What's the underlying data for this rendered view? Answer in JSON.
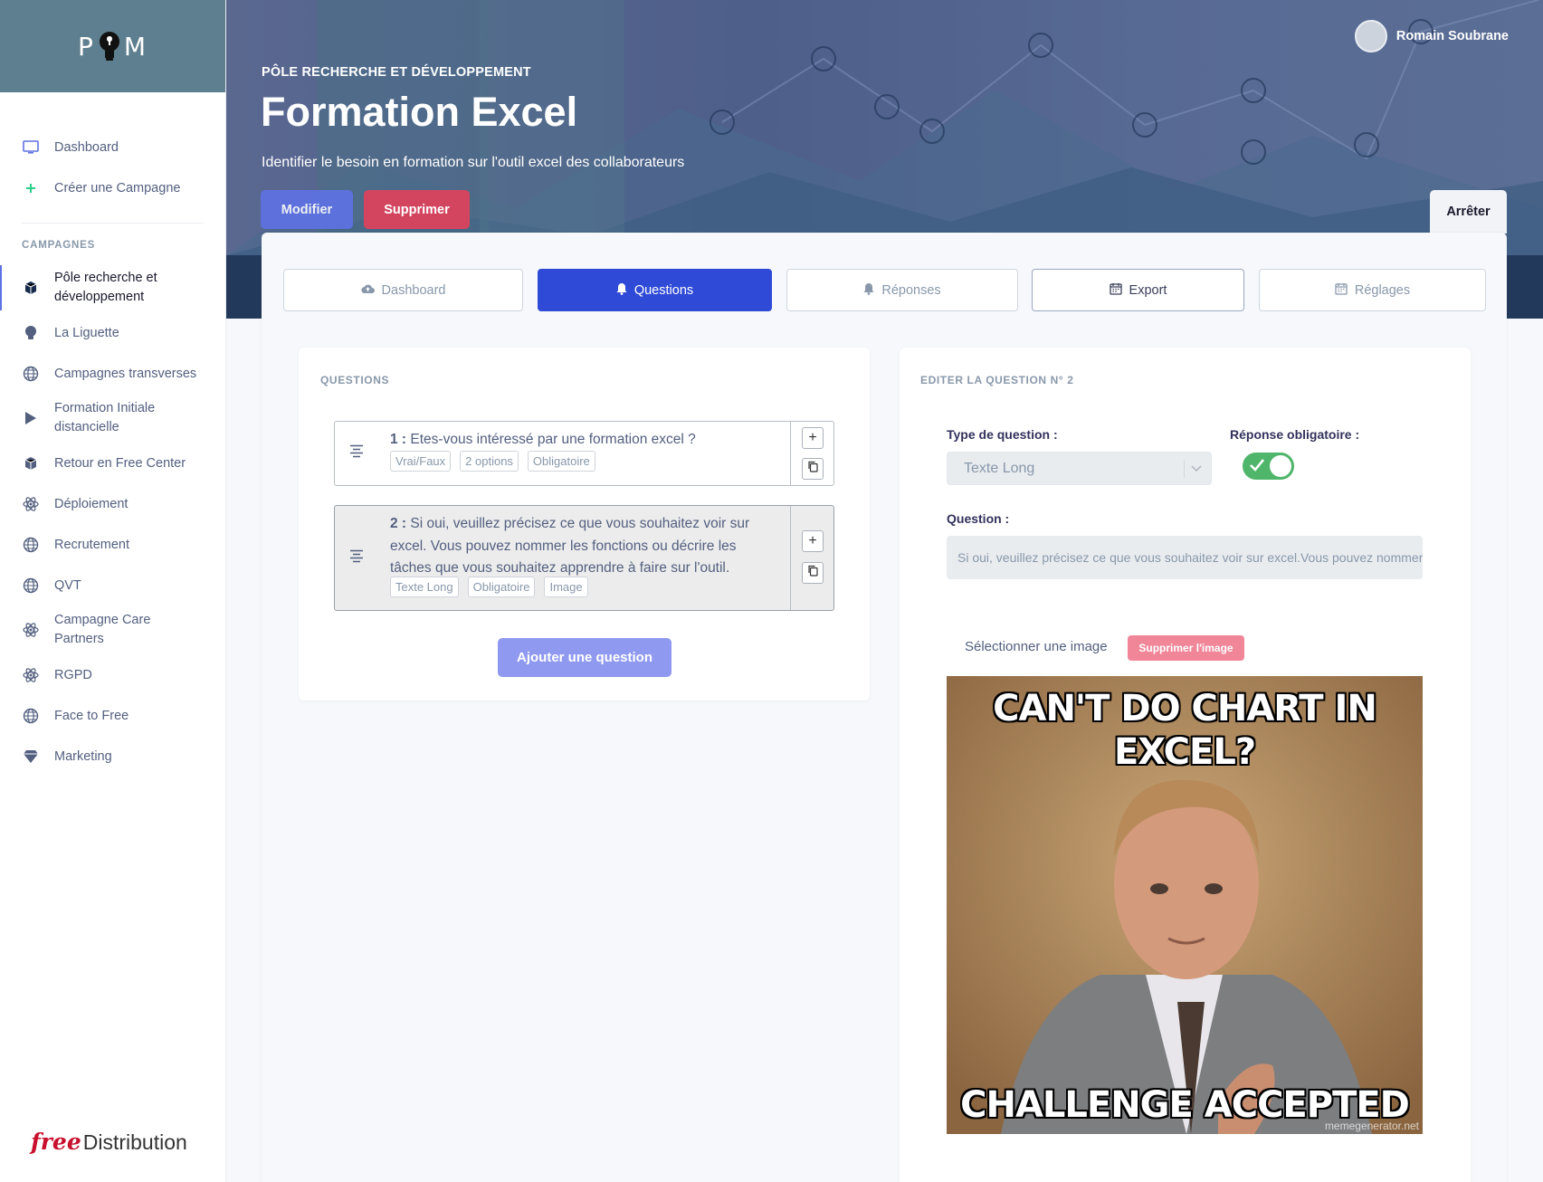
{
  "app": {
    "logo_text_left": "P",
    "logo_text_right": "M",
    "brand_footer_free": "free",
    "brand_footer_rest": "Distribution"
  },
  "sidebar": {
    "top_items": [
      {
        "label": "Dashboard",
        "icon": "monitor-icon"
      },
      {
        "label": "Créer une Campagne",
        "icon": "plus-icon"
      }
    ],
    "heading": "CAMPAGNES",
    "campaigns": [
      {
        "label": "Pôle recherche et développement",
        "icon": "cube-icon",
        "active": true
      },
      {
        "label": "La Liguette",
        "icon": "bulb-icon"
      },
      {
        "label": "Campagnes transverses",
        "icon": "globe-icon"
      },
      {
        "label": "Formation Initiale distancielle",
        "icon": "play-icon"
      },
      {
        "label": "Retour en Free Center",
        "icon": "cube-icon"
      },
      {
        "label": "Déploiement",
        "icon": "atom-icon"
      },
      {
        "label": "Recrutement",
        "icon": "globe-icon"
      },
      {
        "label": "QVT",
        "icon": "globe-icon"
      },
      {
        "label": "Campagne Care Partners",
        "icon": "atom-icon"
      },
      {
        "label": "RGPD",
        "icon": "atom-icon"
      },
      {
        "label": "Face to Free",
        "icon": "globe-icon"
      },
      {
        "label": "Marketing",
        "icon": "diamond-icon"
      }
    ]
  },
  "header": {
    "subtitle": "PÔLE RECHERCHE ET DÉVELOPPEMENT",
    "title": "Formation Excel",
    "description": "Identifier le besoin en formation sur l'outil excel des collaborateurs",
    "modify_label": "Modifier",
    "delete_label": "Supprimer",
    "stop_label": "Arrêter",
    "user_name": "Romain Soubrane"
  },
  "tabs": [
    {
      "label": "Dashboard",
      "icon": "cloud-icon"
    },
    {
      "label": "Questions",
      "icon": "bell-icon",
      "active": true
    },
    {
      "label": "Réponses",
      "icon": "bell-icon"
    },
    {
      "label": "Export",
      "icon": "calendar-icon"
    },
    {
      "label": "Réglages",
      "icon": "calendar-icon"
    }
  ],
  "questions_panel": {
    "title": "QUESTIONS",
    "questions": [
      {
        "number": "1 :",
        "text": "Etes-vous intéressé par une formation excel ?",
        "tags": [
          "Vrai/Faux",
          "2 options",
          "Obligatoire"
        ]
      },
      {
        "number": "2 :",
        "text": "Si oui, veuillez précisez ce que vous souhaitez voir sur excel. Vous pouvez nommer les fonctions ou décrire les tâches que vous souhaitez apprendre à faire sur l'outil.",
        "tags": [
          "Texte Long",
          "Obligatoire",
          "Image"
        ]
      }
    ],
    "add_label": "Ajouter une question",
    "add_symbol": "+"
  },
  "edit_panel": {
    "title": "EDITER LA QUESTION N° 2",
    "type_label": "Type de question :",
    "type_value": "Texte Long",
    "required_label": "Réponse obligatoire :",
    "required_value": true,
    "question_label": "Question :",
    "question_value": "Si oui, veuillez précisez ce que vous souhaitez voir sur excel.Vous pouvez nommer les fonctions ou décrire les tâches que vous souhaitez apprendre à faire sur l'outil.",
    "select_image_label": "Sélectionner une image",
    "delete_image_label": "Supprimer l'image",
    "image_caption_top": "CAN'T DO CHART IN EXCEL?",
    "image_caption_bottom": "CHALLENGE ACCEPTED",
    "image_watermark": "memegenerator.net"
  },
  "colors": {
    "primary": "#2f4ad6",
    "danger": "#d3455f",
    "success": "#4fb56a",
    "header_band": "#23395b"
  }
}
